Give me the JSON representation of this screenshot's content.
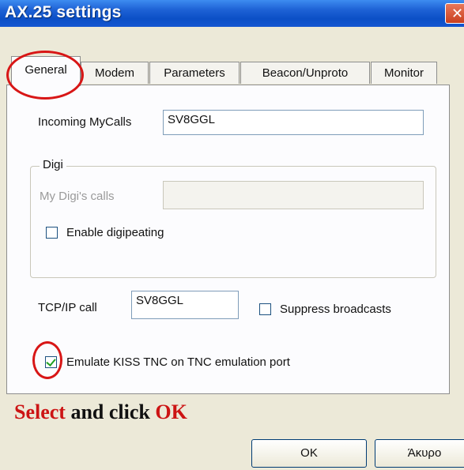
{
  "window": {
    "title": "AX.25 settings",
    "close_glyph": "✕"
  },
  "tabs": [
    {
      "label": "General",
      "active": true
    },
    {
      "label": "Modem",
      "active": false
    },
    {
      "label": "Parameters",
      "active": false
    },
    {
      "label": "Beacon/Unproto",
      "active": false
    },
    {
      "label": "Monitor",
      "active": false
    }
  ],
  "general": {
    "incoming_mycalls_label": "Incoming MyCalls",
    "incoming_mycalls_value": "SV8GGL",
    "digi": {
      "group_title": "Digi",
      "my_digis_calls_label": "My Digi's calls",
      "my_digis_calls_value": "",
      "enable_digipeating_label": "Enable digipeating",
      "enable_digipeating_checked": false
    },
    "tcpip_call_label": "TCP/IP call",
    "tcpip_call_value": "SV8GGL",
    "suppress_broadcasts_label": "Suppress broadcasts",
    "suppress_broadcasts_checked": false,
    "emulate_kiss_label": "Emulate KISS TNC on TNC emulation port",
    "emulate_kiss_checked": true
  },
  "annotation": {
    "word_select": "Select",
    "word_and_click": " and click ",
    "word_ok": "OK"
  },
  "buttons": {
    "ok_label": "OK",
    "cancel_label": "Άκυρο"
  },
  "colors": {
    "annotation_red": "#cc1414",
    "titlebar_blue": "#0b4fc6",
    "checkmark_green": "#21a121"
  }
}
